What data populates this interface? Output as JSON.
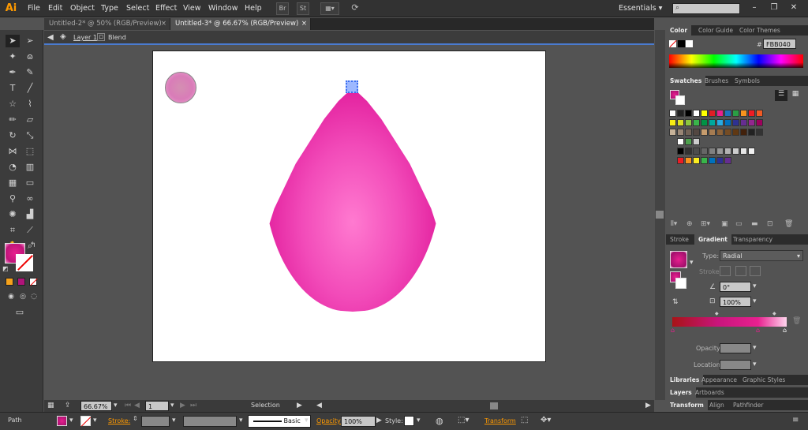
{
  "app": {
    "logo": "Ai"
  },
  "menu": [
    "File",
    "Edit",
    "Object",
    "Type",
    "Select",
    "Effect",
    "View",
    "Window",
    "Help"
  ],
  "menubar_buttons": [
    "Br",
    "St"
  ],
  "workspace": "Essentials",
  "tabs": [
    {
      "label": "Untitled-2* @ 50% (RGB/Preview)"
    },
    {
      "label": "Untitled-3* @ 66.67% (RGB/Preview)"
    }
  ],
  "breadcrumb": {
    "layer": "Layer 1",
    "object": "Blend"
  },
  "status": {
    "zoom": "66.67%",
    "page": "1",
    "tool": "Selection"
  },
  "controlbar": {
    "object_type": "Path",
    "stroke_label": "Stroke:",
    "brush": "Basic",
    "opacity_label": "Opacity:",
    "opacity": "100%",
    "style_label": "Style:",
    "transform": "Transform"
  },
  "panels": {
    "color": {
      "tabs": [
        "Color",
        "Color Guide",
        "Color Themes"
      ],
      "hex": "FBB040"
    },
    "swatches": {
      "tabs": [
        "Swatches",
        "Brushes",
        "Symbols"
      ]
    },
    "gradient": {
      "tabs": [
        "Stroke",
        "Gradient",
        "Transparency"
      ],
      "type_label": "Type:",
      "type": "Radial",
      "stroke_label": "Stroke",
      "angle": "0°",
      "aspect": "100%",
      "opacity_label": "Opacity:",
      "location_label": "Location:"
    },
    "libraries": {
      "tabs": [
        "Libraries",
        "Appearance",
        "Graphic Styles"
      ]
    },
    "layers": {
      "tabs": [
        "Layers",
        "Artboards"
      ]
    },
    "transform": {
      "tabs": [
        "Transform",
        "Align",
        "Pathfinder"
      ]
    }
  },
  "colors": {
    "fill_pink": "#e8208f",
    "accent": "#ff9a00"
  }
}
